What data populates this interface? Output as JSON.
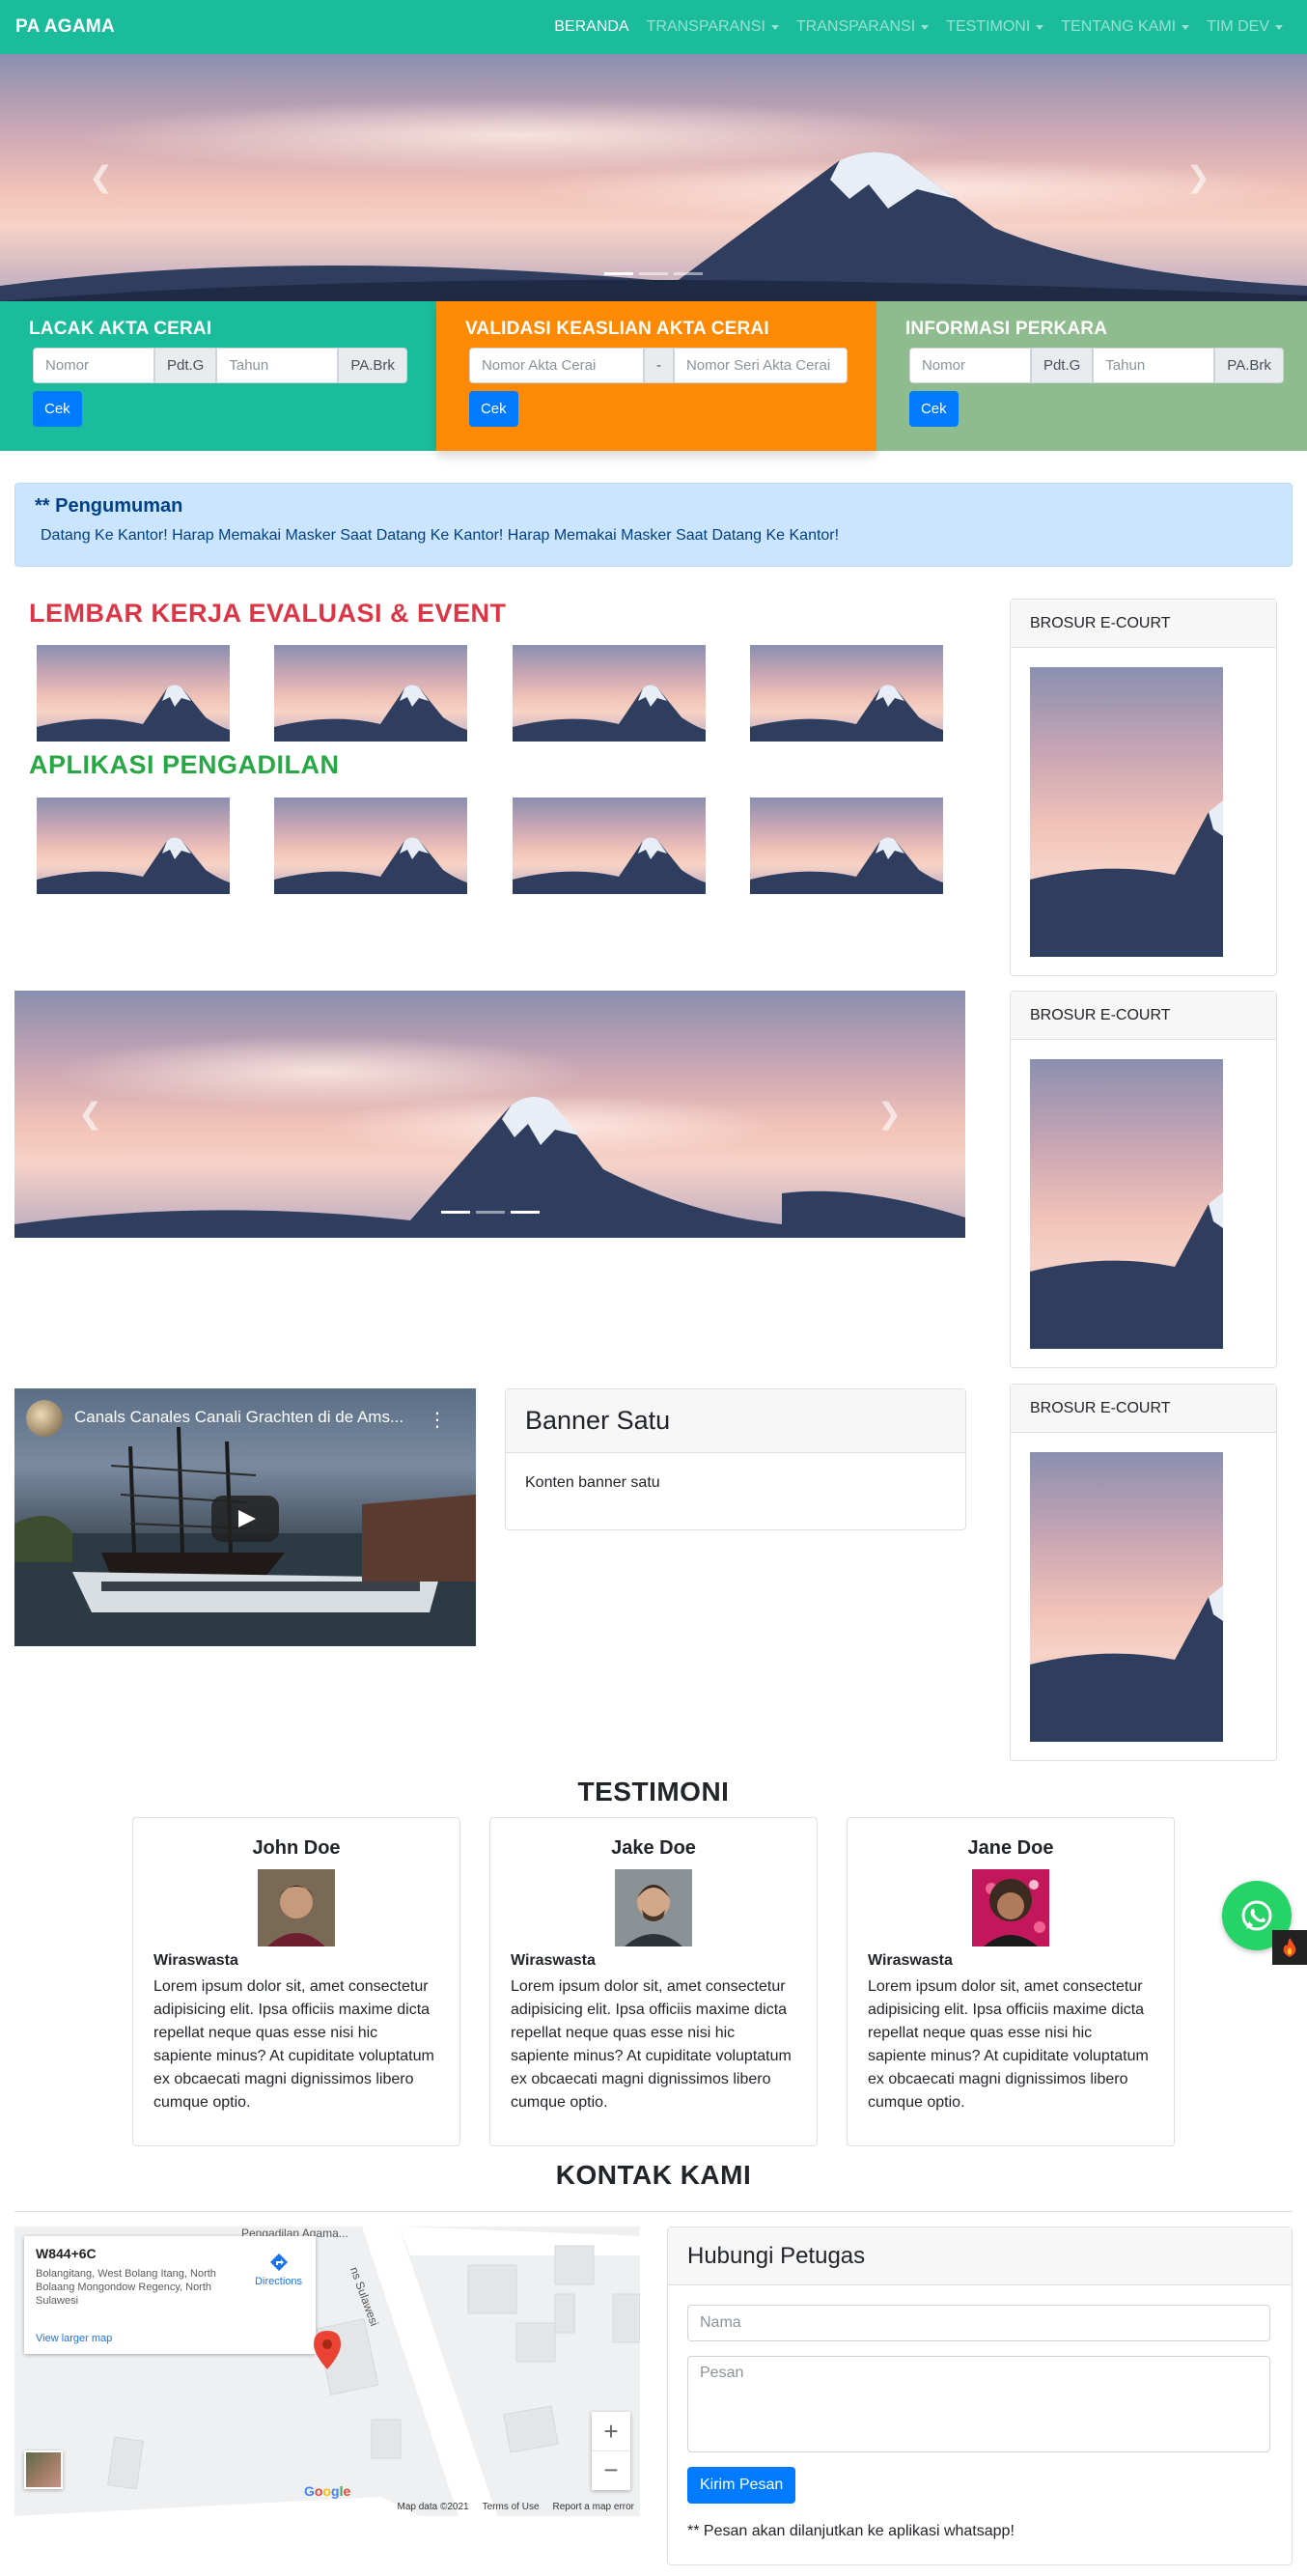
{
  "navbar": {
    "brand": "PA AGAMA",
    "items": [
      {
        "label": "BERANDA",
        "dropdown": false,
        "active": true
      },
      {
        "label": "TRANSPARANSI",
        "dropdown": true,
        "active": false
      },
      {
        "label": "TRANSPARANSI",
        "dropdown": true,
        "active": false
      },
      {
        "label": "TESTIMONI",
        "dropdown": true,
        "active": false
      },
      {
        "label": "TENTANG KAMI",
        "dropdown": true,
        "active": false
      },
      {
        "label": "TIM DEV",
        "dropdown": true,
        "active": false
      }
    ]
  },
  "hero": {
    "slides": 3,
    "active_slide": 1,
    "prev_icon": "chevron-left-icon",
    "next_icon": "chevron-right-icon"
  },
  "panels": {
    "lacak": {
      "title": "LACAK AKTA CERAI",
      "nomor_placeholder": "Nomor",
      "addon1": "Pdt.G",
      "tahun_placeholder": "Tahun",
      "addon2": "PA.Brk",
      "button": "Cek",
      "color": "#1abc9c"
    },
    "validasi": {
      "title": "VALIDASI KEASLIAN AKTA CERAI",
      "akta_placeholder": "Nomor Akta Cerai",
      "separator": "-",
      "seri_placeholder": "Nomor Seri Akta Cerai",
      "button": "Cek",
      "color": "#fd8a05"
    },
    "perkara": {
      "title": "INFORMASI PERKARA",
      "nomor_placeholder": "Nomor",
      "addon1": "Pdt.G",
      "tahun_placeholder": "Tahun",
      "addon2": "PA.Brk",
      "button": "Cek",
      "color": "#8fbc8f"
    }
  },
  "announcement": {
    "title": "** Pengumuman",
    "text": "Datang Ke Kantor! Harap Memakai Masker Saat Datang Ke Kantor! Harap Memakai Masker Saat Datang Ke Kantor!"
  },
  "sections": {
    "lembar": {
      "title": "LEMBAR KERJA EVALUASI & EVENT",
      "color": "#dc3545"
    },
    "aplikasi": {
      "title": "APLIKASI PENGADILAN",
      "color": "#28a745"
    }
  },
  "sidebar": {
    "cards": [
      {
        "title": "BROSUR E-COURT"
      },
      {
        "title": "BROSUR E-COURT"
      },
      {
        "title": "BROSUR E-COURT"
      }
    ]
  },
  "video": {
    "title": "Canals Canales Canali Grachten di de Ams...",
    "menu_icon": "more-vert-icon",
    "play_icon": "play-icon"
  },
  "banner": {
    "title": "Banner Satu",
    "content": "Konten banner satu"
  },
  "testimoni": {
    "title": "TESTIMONI",
    "items": [
      {
        "name": "John Doe",
        "role": "Wiraswasta",
        "text": "Lorem ipsum dolor sit, amet consectetur adipisicing elit. Ipsa officiis maxime dicta repellat neque quas esse nisi hic sapiente minus? At cupiditate voluptatum ex obcaecati magni dignissimos libero cumque optio."
      },
      {
        "name": "Jake Doe",
        "role": "Wiraswasta",
        "text": "Lorem ipsum dolor sit, amet consectetur adipisicing elit. Ipsa officiis maxime dicta repellat neque quas esse nisi hic sapiente minus? At cupiditate voluptatum ex obcaecati magni dignissimos libero cumque optio."
      },
      {
        "name": "Jane Doe",
        "role": "Wiraswasta",
        "text": "Lorem ipsum dolor sit, amet consectetur adipisicing elit. Ipsa officiis maxime dicta repellat neque quas esse nisi hic sapiente minus? At cupiditate voluptatum ex obcaecati magni dignissimos libero cumque optio."
      }
    ]
  },
  "contact": {
    "title": "KONTAK KAMI",
    "map": {
      "place_code": "W844+6C",
      "address": "Bolangitang, West Bolang Itang, North Bolaang Mongondow Regency, North Sulawesi",
      "directions": "Directions",
      "larger_map": "View larger map",
      "top_label": "Pengadilan Agama...",
      "road_label": "ns Sulawesi",
      "zoom_in": "+",
      "zoom_out": "−",
      "logo": "Google",
      "data": "Map data ©2021",
      "terms": "Terms of Use",
      "report": "Report a map error"
    },
    "form": {
      "title": "Hubungi Petugas",
      "name_placeholder": "Nama",
      "message_placeholder": "Pesan",
      "button": "Kirim Pesan",
      "note": "** Pesan akan dilanjutkan ke aplikasi whatsapp!"
    }
  },
  "floating": {
    "whatsapp_icon": "whatsapp-icon",
    "fire_icon": "fire-icon"
  }
}
